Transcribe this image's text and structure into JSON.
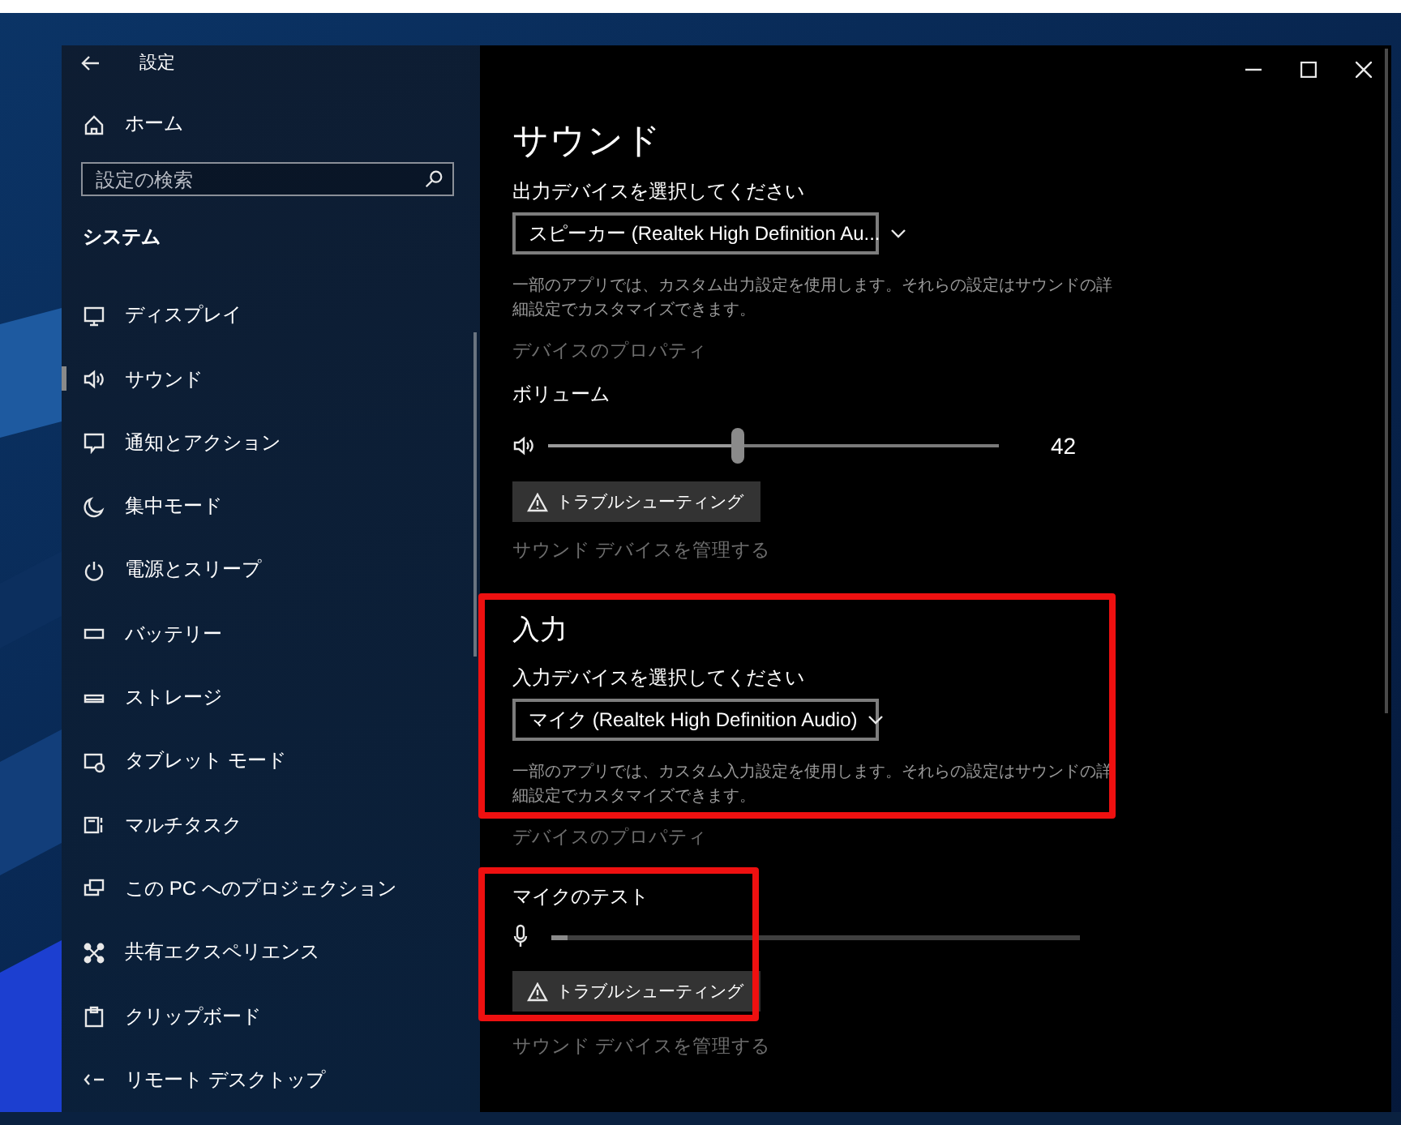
{
  "window": {
    "title": "設定"
  },
  "sidebar": {
    "home": "ホーム",
    "search": {
      "placeholder": "設定の検索"
    },
    "section": "システム",
    "items": [
      {
        "label": "ディスプレイ",
        "selected": false
      },
      {
        "label": "サウンド",
        "selected": true
      },
      {
        "label": "通知とアクション",
        "selected": false
      },
      {
        "label": "集中モード",
        "selected": false
      },
      {
        "label": "電源とスリープ",
        "selected": false
      },
      {
        "label": "バッテリー",
        "selected": false
      },
      {
        "label": "ストレージ",
        "selected": false
      },
      {
        "label": "タブレット モード",
        "selected": false
      },
      {
        "label": "マルチタスク",
        "selected": false
      },
      {
        "label": "この PC へのプロジェクション",
        "selected": false
      },
      {
        "label": "共有エクスペリエンス",
        "selected": false
      },
      {
        "label": "クリップボード",
        "selected": false
      },
      {
        "label": "リモート デスクトップ",
        "selected": false
      }
    ]
  },
  "page": {
    "title": "サウンド",
    "output": {
      "label": "出力デバイスを選択してください",
      "device": "スピーカー (Realtek High Definition Au...",
      "description": "一部のアプリでは、カスタム出力設定を使用します。それらの設定はサウンドの詳細設定でカスタマイズできます。",
      "properties_link": "デバイスのプロパティ"
    },
    "volume": {
      "label": "ボリューム",
      "level": 0.42,
      "reading": "42",
      "button": "トラブルシューティング"
    },
    "manage_link": "サウンド デバイスを管理する",
    "input": {
      "heading": "入力",
      "label": "入力デバイスを選択してください",
      "device": "マイク (Realtek High Definition Audio)",
      "description": "一部のアプリでは、カスタム入力設定を使用します。それらの設定はサウンドの詳細設定でカスタマイズできます。",
      "properties_link": "デバイスのプロパティ"
    },
    "mic_test": {
      "label": "マイクのテスト",
      "level": 0.03,
      "button": "トラブルシューティング"
    },
    "input_manage_link": "サウンド デバイスを管理する"
  }
}
